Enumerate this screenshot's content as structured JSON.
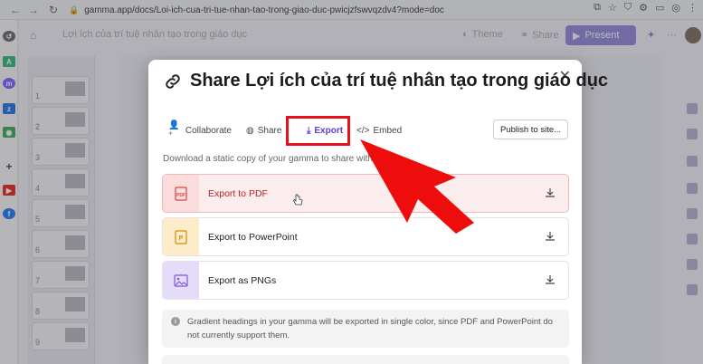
{
  "browser": {
    "url": "gamma.app/docs/Loi-ich-cua-tri-tue-nhan-tao-trong-giao-duc-pwicjzfswvqzdv4?mode=doc"
  },
  "app": {
    "breadcrumb": "Lợi ích của trí tuệ nhân tạo trong giáo dục",
    "theme_label": "Theme",
    "share_label": "Share",
    "present_label": "Present",
    "slide_numbers": [
      "1",
      "2",
      "3",
      "4",
      "5",
      "6",
      "7",
      "8",
      "9"
    ]
  },
  "modal": {
    "title": "Share Lợi ích của trí tuệ nhân tạo trong giáo dục",
    "tabs": {
      "collaborate": "Collaborate",
      "share": "Share",
      "export": "Export",
      "embed": "Embed"
    },
    "publish_label": "Publish to site...",
    "description": "Download a static copy of your gamma to share with others.",
    "options": {
      "pdf": "Export to PDF",
      "ppt": "Export to PowerPoint",
      "png": "Export as PNGs"
    },
    "pdf_icon_text": "PDF",
    "info_text": "Gradient headings in your gamma will be exported in single color, since PDF and PowerPoint do not currently support them."
  },
  "colors": {
    "accent": "#5b3fd8",
    "highlight": "#e8101a"
  }
}
